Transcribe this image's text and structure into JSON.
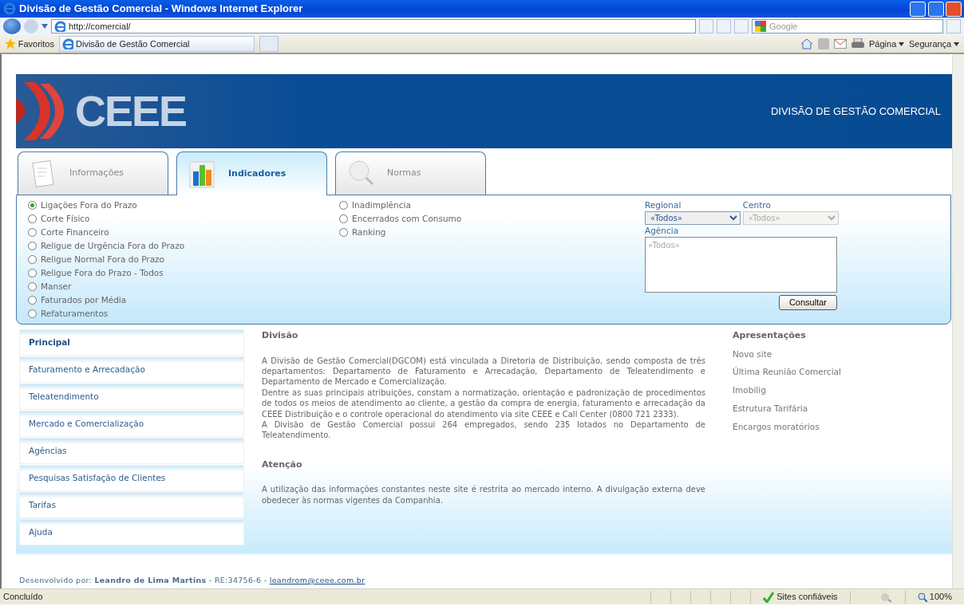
{
  "browser": {
    "title": "Divisão de Gestão Comercial - Windows Internet Explorer",
    "address": "http://comercial/",
    "search_placeholder": "Google",
    "favorites": "Favoritos",
    "tab_title": "Divisão de Gestão Comercial",
    "menus": [
      "Página",
      "Segurança"
    ],
    "status": "Concluído",
    "zone": "Sites confiáveis",
    "zoom": "100%"
  },
  "header": {
    "logo": "CEEE",
    "title": "DIVISÃO DE GESTÃO COMERCIAL"
  },
  "tabs": [
    {
      "label": "Informações",
      "selected": false
    },
    {
      "label": "Indicadores",
      "selected": true
    },
    {
      "label": "Normas",
      "selected": false
    }
  ],
  "indicators": [
    [
      {
        "label": "Ligações Fora do Prazo",
        "selected": true
      },
      {
        "label": "Corte Físico",
        "selected": false
      },
      {
        "label": "Corte Financeiro",
        "selected": false
      },
      {
        "label": "Religue de Urgência Fora do Prazo",
        "selected": false
      },
      {
        "label": "Religue Normal Fora do Prazo",
        "selected": false
      },
      {
        "label": "Religue Fora do Prazo - Todos",
        "selected": false
      },
      {
        "label": "Manser",
        "selected": false
      },
      {
        "label": "Faturados por Média",
        "selected": false
      },
      {
        "label": "Refaturamentos",
        "selected": false
      }
    ],
    [
      {
        "label": "Inadimplência",
        "selected": false
      },
      {
        "label": "Encerrados com Consumo",
        "selected": false
      },
      {
        "label": "Ranking",
        "selected": false
      }
    ]
  ],
  "filters": {
    "regional": {
      "label": "Regional",
      "value": "«Todos»",
      "disabled": false
    },
    "centro": {
      "label": "Centro",
      "value": "«Todos»",
      "disabled": true
    },
    "agencia": {
      "label": "Agência",
      "placeholder": "«Todos»"
    },
    "button": "Consultar"
  },
  "nav": [
    {
      "label": "Principal",
      "selected": true
    },
    {
      "label": "Faturamento e Arrecadação",
      "selected": false
    },
    {
      "label": "Teleatendimento",
      "selected": false
    },
    {
      "label": "Mercado e Comercialização",
      "selected": false
    },
    {
      "label": "Agências",
      "selected": false
    },
    {
      "label": "Pesquisas Satisfação de Clientes",
      "selected": false
    },
    {
      "label": "Tarifas",
      "selected": false
    },
    {
      "label": "Ajuda",
      "selected": false
    }
  ],
  "sections": [
    {
      "heading": "Divisão",
      "paragraphs": [
        "A Divisão de Gestão Comercial(DGCOM) está vinculada a Diretoria de Distribuição, sendo composta de três departamentos: Departamento de Faturamento e Arrecadação, Departamento de Teleatendimento e Departamento de Mercado e Comercialização.",
        "Dentre as suas principais atribuições, constam a normatização, orientação e padronização de procedimentos de todos os meios de atendimento ao cliente, a gestão da compra de energia, faturamento e arrecadação da CEEE Distribuição e o controle operacional do atendimento via site CEEE e Call Center (0800 721 2333).",
        "A Divisão de Gestão Comercial possui 264 empregados, sendo 235 lotados no Departamento de Teleatendimento."
      ]
    },
    {
      "heading": "Atenção",
      "paragraphs": [
        "A utilização das informações constantes neste site é restrita ao mercado interno. A divulgação externa deve obedecer às normas vigentes da Companhia."
      ]
    }
  ],
  "presentations": {
    "heading": "Apresentações",
    "links": [
      "Novo site",
      "Última Reunião Comercial",
      "Imobilig",
      "Estrutura Tarifária",
      "Encargos moratórios"
    ]
  },
  "footer": {
    "label": "Desenvolvido por:",
    "author": "Leandro de Lima Martins",
    "registration": "- RE:34756-6 -",
    "email": "leandrom@ceee.com.br"
  }
}
